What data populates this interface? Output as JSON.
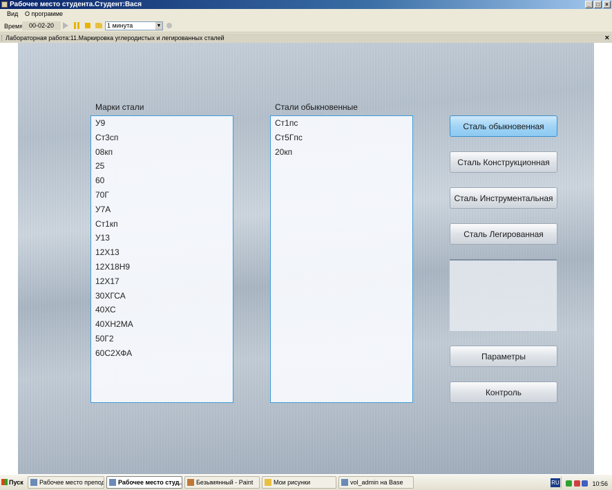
{
  "window": {
    "title": "Рабочее место студента.Студент:Вася"
  },
  "menu": {
    "items": [
      "Вид",
      "О программе"
    ]
  },
  "toolbar": {
    "time_label": "Время",
    "time_value": "00-02-20",
    "interval_selected": "1 минута"
  },
  "document": {
    "title": "Лабораторная работа:11.Маркировка углеродистых и легированных сталей"
  },
  "steel_grades": {
    "label": "Марки стали",
    "items": [
      "У9",
      "Ст3сп",
      "08кп",
      "25",
      "60",
      "70Г",
      "У7А",
      "Ст1кп",
      "У13",
      "12Х13",
      "12Х18Н9",
      "12Х17",
      "30ХГСА",
      "40ХС",
      "40ХН2МА",
      "50Г2",
      "60С2ХФА"
    ]
  },
  "ordinary_steels": {
    "label": "Стали обыкновенные",
    "items": [
      "Ст1пс",
      "Ст5Гпс",
      "20кп"
    ]
  },
  "buttons": {
    "ordinary": "Сталь обыкновенная",
    "structural": "Сталь Конструкционная",
    "tool": "Сталь Инструментальная",
    "alloyed": "Сталь Легированная",
    "params": "Параметры",
    "control": "Контроль"
  },
  "taskbar": {
    "start": "Пуск",
    "tasks": [
      "Рабочее место препода...",
      "Рабочее место студ...",
      "Безымянный - Paint",
      "Мои рисунки",
      "vol_admin на Base"
    ],
    "lang": "RU",
    "clock": "10:56"
  }
}
